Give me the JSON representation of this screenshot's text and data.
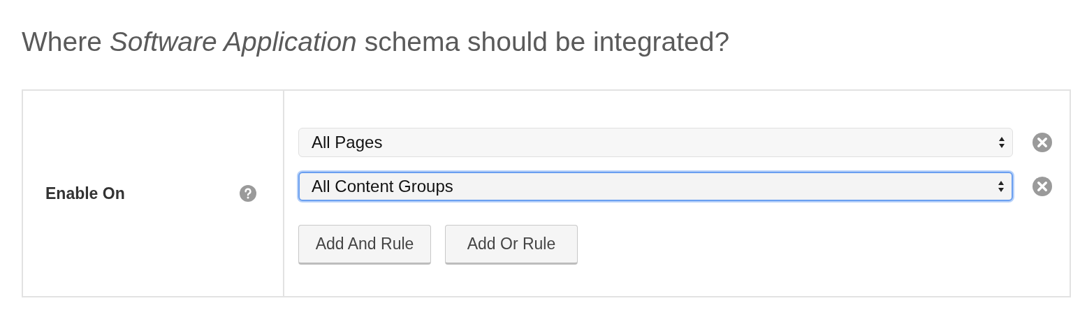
{
  "heading": "Where *Software Application* schema should be integrated?",
  "setting": {
    "label": "Enable On",
    "rules": [
      {
        "value": "All Pages",
        "focused": false
      },
      {
        "value": "All Content Groups",
        "focused": true
      }
    ],
    "buttons": [
      "Add And Rule",
      "Add Or Rule"
    ]
  }
}
